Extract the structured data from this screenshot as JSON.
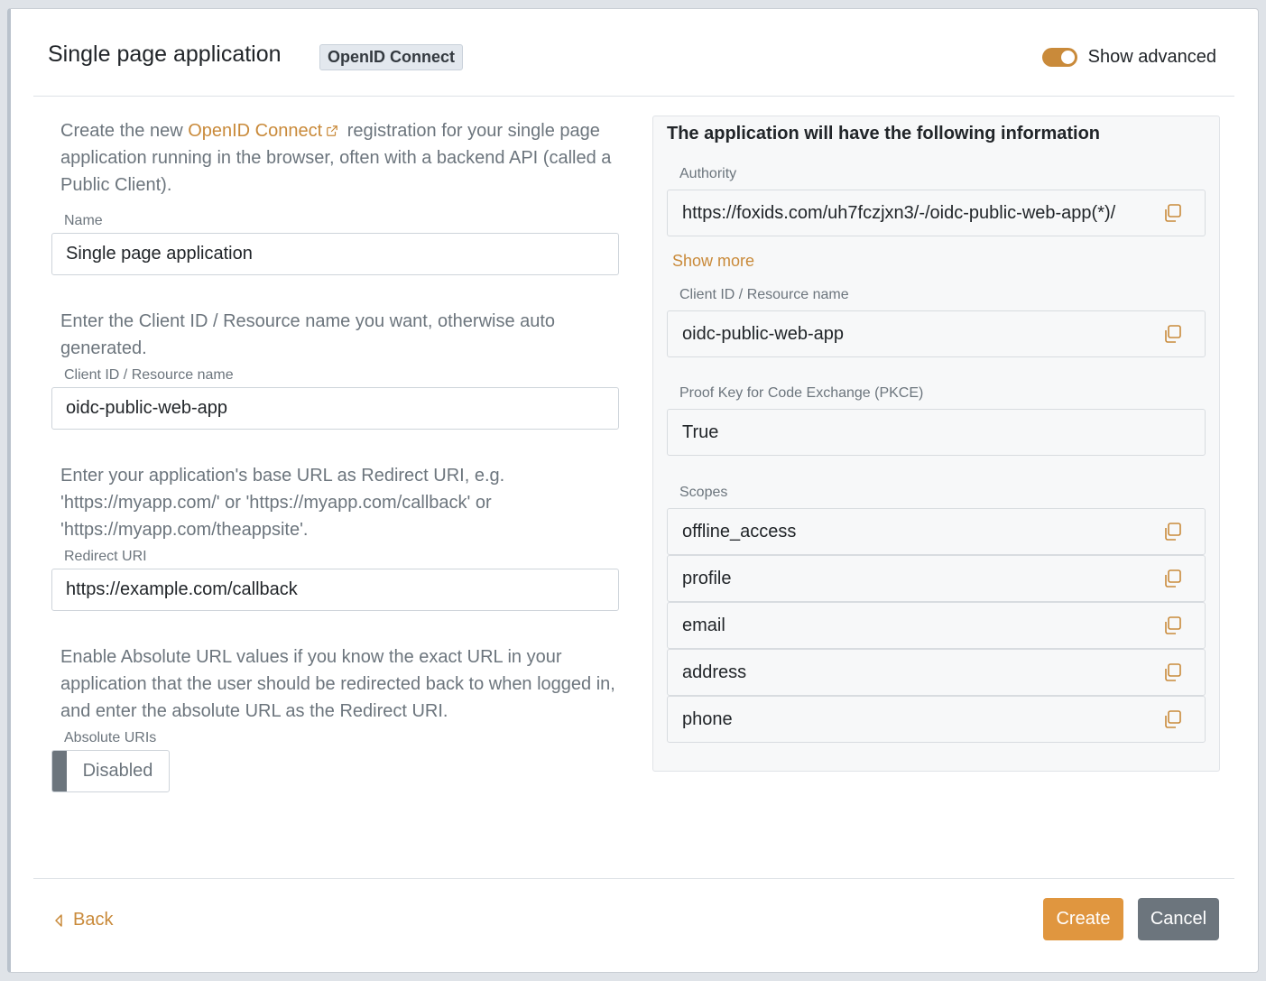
{
  "header": {
    "title": "Single page application",
    "badge": "OpenID Connect",
    "advanced_label": "Show advanced",
    "advanced_on": true
  },
  "left": {
    "intro_pre": "Create the new ",
    "intro_link": "OpenID Connect",
    "intro_post": " registration for your single page application running in the browser, often with a backend API (called a Public Client).",
    "name_label": "Name",
    "name_value": "Single page application",
    "client_help": "Enter the Client ID / Resource name you want, otherwise auto generated.",
    "client_label": "Client ID / Resource name",
    "client_value": "oidc-public-web-app",
    "redirect_help": "Enter your application's base URL as Redirect URI, e.g. 'https://myapp.com/' or 'https://myapp.com/callback' or 'https://myapp.com/theappsite'.",
    "redirect_label": "Redirect URI",
    "redirect_value": "https://example.com/callback",
    "absolute_help": "Enable Absolute URL values if you know the exact URL in your application that the user should be redirected back to when logged in, and enter the absolute URL as the Redirect URI.",
    "absolute_label": "Absolute URIs",
    "absolute_value": "Disabled"
  },
  "right": {
    "title": "The application will have the following information",
    "authority_label": "Authority",
    "authority_value": "https://foxids.com/uh7fczjxn3/-/oidc-public-web-app(*)/",
    "show_more": "Show more",
    "client_label": "Client ID / Resource name",
    "client_value": "oidc-public-web-app",
    "pkce_label": "Proof Key for Code Exchange (PKCE)",
    "pkce_value": "True",
    "scopes_label": "Scopes",
    "scopes": [
      "offline_access",
      "profile",
      "email",
      "address",
      "phone"
    ]
  },
  "footer": {
    "back": "Back",
    "create": "Create",
    "cancel": "Cancel"
  },
  "colors": {
    "accent": "#c98a3a",
    "create_button": "#e0963f",
    "cancel_button": "#6c757d"
  }
}
